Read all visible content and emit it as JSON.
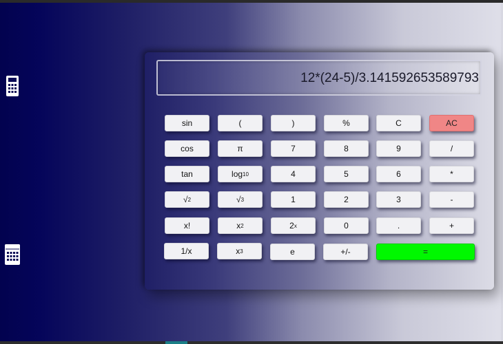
{
  "display": {
    "expression": "12*(24-5)/3.141592653589793"
  },
  "sidebar": {
    "items": [
      {
        "icon": "calculator-icon"
      },
      {
        "icon": "calendar-icon"
      }
    ]
  },
  "keys": {
    "r1": {
      "sin": "sin",
      "lparen": "(",
      "rparen": ")",
      "percent": "%",
      "clear": "C",
      "all_clear": "AC"
    },
    "r2": {
      "cos": "cos",
      "pi": "π",
      "seven": "7",
      "eight": "8",
      "nine": "9",
      "divide": "/"
    },
    "r3": {
      "tan": "tan",
      "log_base": "log",
      "log_sub": "10",
      "four": "4",
      "five": "5",
      "six": "6",
      "multiply": "*"
    },
    "r4": {
      "root_sym": "√",
      "root_sup": "2",
      "cbrt_sym": "√",
      "cbrt_sup": "3",
      "one": "1",
      "two": "2",
      "three": "3",
      "minus": "-"
    },
    "r5": {
      "factorial": "x!",
      "square_base": "x",
      "square_sup": "2",
      "pow2_base": "2",
      "pow2_sup": "x",
      "zero": "0",
      "decimal": ".",
      "plus": "+"
    },
    "r6": {
      "reciprocal": "1/x",
      "cube_base": "x",
      "cube_sup": "3",
      "euler": "e",
      "negate": "+/-",
      "equals": "="
    }
  },
  "colors": {
    "all_clear": "#f08686",
    "equals": "#00f800",
    "key_bg": "#f1f1f4"
  }
}
